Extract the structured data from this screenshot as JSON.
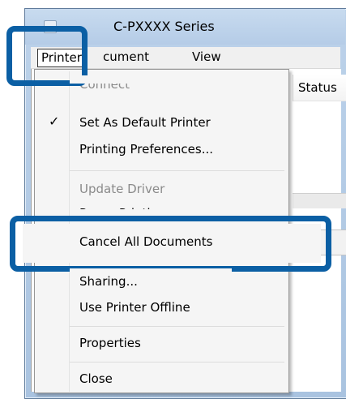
{
  "window": {
    "title": "C-PXXXX Series"
  },
  "menubar": {
    "printer": "Printer",
    "document": "cument",
    "view": "View"
  },
  "list": {
    "status_header": "Status"
  },
  "printer_menu": {
    "items": [
      {
        "label": "Connect",
        "enabled": false,
        "checked": false
      },
      {
        "label": "Set As Default Printer",
        "enabled": true,
        "checked": true
      },
      {
        "label": "Printing Preferences...",
        "enabled": true,
        "checked": false
      },
      {
        "label": "Update Driver",
        "enabled": false,
        "checked": false
      },
      {
        "label": "Pause Printing",
        "enabled": true,
        "checked": false
      },
      {
        "label": "Cancel All Documents",
        "enabled": true,
        "checked": false
      },
      {
        "label": "Sharing...",
        "enabled": true,
        "checked": false
      },
      {
        "label": "Use Printer Offline",
        "enabled": true,
        "checked": false
      },
      {
        "label": "Properties",
        "enabled": true,
        "checked": false
      },
      {
        "label": "Close",
        "enabled": true,
        "checked": false
      }
    ],
    "check_glyph": "✓"
  },
  "colors": {
    "highlight": "#0b5fa4",
    "menu_bg": "#f5f5f5",
    "disabled_text": "#8a8a8a"
  }
}
